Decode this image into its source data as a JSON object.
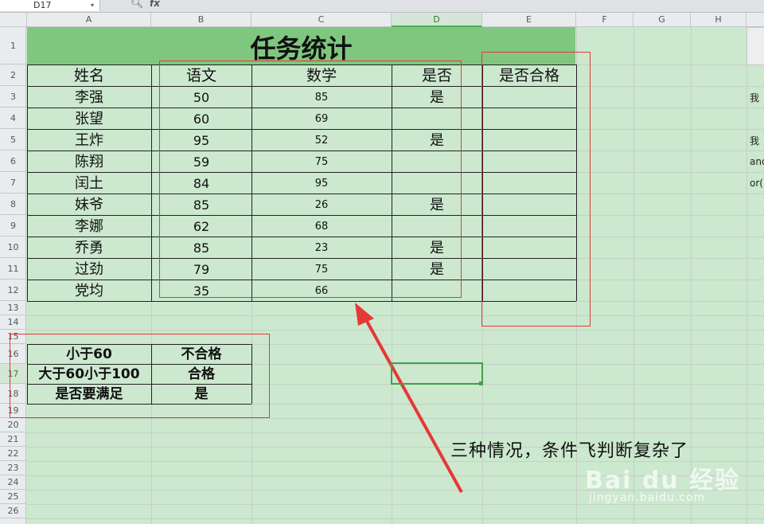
{
  "formula_bar": {
    "name_box": "D17",
    "fx_label": "fx"
  },
  "columns": [
    "A",
    "B",
    "C",
    "D",
    "E",
    "F",
    "G",
    "H"
  ],
  "rows": [
    "1",
    "2",
    "3",
    "4",
    "5",
    "6",
    "7",
    "8",
    "9",
    "10",
    "11",
    "12",
    "13",
    "14",
    "15",
    "16",
    "17",
    "18",
    "19",
    "20",
    "21",
    "22",
    "23",
    "24",
    "25",
    "26"
  ],
  "title": "任务统计",
  "table": {
    "headers": [
      "姓名",
      "语文",
      "数学",
      "是否",
      "是否合格"
    ],
    "rows": [
      [
        "李强",
        "50",
        "85",
        "是",
        ""
      ],
      [
        "张望",
        "60",
        "69",
        "",
        ""
      ],
      [
        "王炸",
        "95",
        "52",
        "是",
        ""
      ],
      [
        "陈翔",
        "59",
        "75",
        "",
        ""
      ],
      [
        "闰土",
        "84",
        "95",
        "",
        ""
      ],
      [
        "妹爷",
        "85",
        "26",
        "是",
        ""
      ],
      [
        "李娜",
        "62",
        "68",
        "",
        ""
      ],
      [
        "乔勇",
        "85",
        "23",
        "是",
        ""
      ],
      [
        "过劲",
        "79",
        "75",
        "是",
        ""
      ],
      [
        "党均",
        "35",
        "66",
        "",
        ""
      ]
    ]
  },
  "rules_table": [
    [
      "小于60",
      "不合格"
    ],
    [
      "大于60小于100",
      "合格"
    ],
    [
      "是否要满足",
      "是"
    ]
  ],
  "annotation": "三种情况，条件飞判断复杂了",
  "side_text": [
    "我",
    "我",
    "and",
    "or("
  ],
  "watermark": {
    "main": "Bai du 经验",
    "sub": "jingyan.baidu.com"
  },
  "colors": {
    "sheet_bg": "#cce8cf",
    "title_fill": "#7fc77f",
    "annotation_red": "#e53935",
    "active_cell": "#43a047"
  }
}
